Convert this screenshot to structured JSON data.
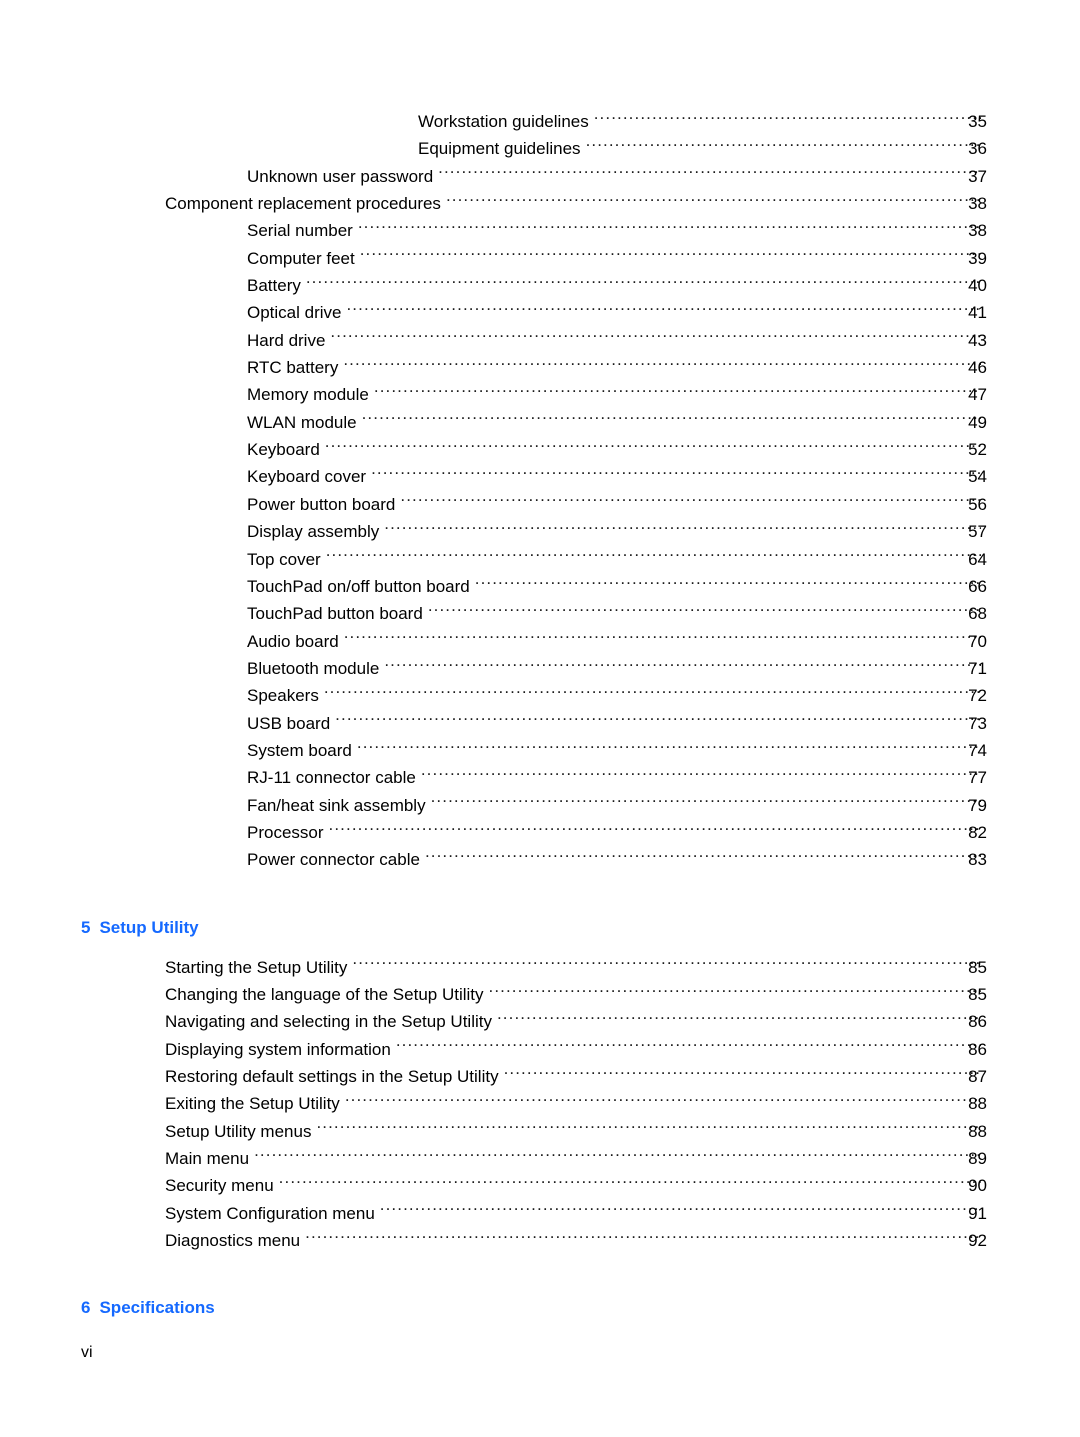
{
  "page": {
    "folio": "vi",
    "heading_color": "#1569ff",
    "text_color": "#000000",
    "background": "#ffffff"
  },
  "toc": {
    "blocks": [
      {
        "type": "entries",
        "entries": [
          {
            "title": "Workstation guidelines",
            "page": "35",
            "level": 3
          },
          {
            "title": "Equipment guidelines",
            "page": "36",
            "level": 3
          },
          {
            "title": "Unknown user password",
            "page": "37",
            "level": 2
          },
          {
            "title": "Component replacement procedures",
            "page": "38",
            "level": 1
          },
          {
            "title": "Serial number",
            "page": "38",
            "level": 2
          },
          {
            "title": "Computer feet",
            "page": "39",
            "level": 2
          },
          {
            "title": "Battery",
            "page": "40",
            "level": 2
          },
          {
            "title": "Optical drive",
            "page": "41",
            "level": 2
          },
          {
            "title": "Hard drive",
            "page": "43",
            "level": 2
          },
          {
            "title": "RTC battery",
            "page": "46",
            "level": 2
          },
          {
            "title": "Memory module",
            "page": "47",
            "level": 2
          },
          {
            "title": "WLAN module",
            "page": "49",
            "level": 2
          },
          {
            "title": "Keyboard",
            "page": "52",
            "level": 2
          },
          {
            "title": "Keyboard cover",
            "page": "54",
            "level": 2
          },
          {
            "title": "Power button board",
            "page": "56",
            "level": 2
          },
          {
            "title": "Display assembly",
            "page": "57",
            "level": 2
          },
          {
            "title": "Top cover",
            "page": "64",
            "level": 2
          },
          {
            "title": "TouchPad on/off button board",
            "page": "66",
            "level": 2
          },
          {
            "title": "TouchPad button board",
            "page": "68",
            "level": 2
          },
          {
            "title": "Audio board",
            "page": "70",
            "level": 2
          },
          {
            "title": "Bluetooth module",
            "page": "71",
            "level": 2
          },
          {
            "title": "Speakers",
            "page": "72",
            "level": 2
          },
          {
            "title": "USB board",
            "page": "73",
            "level": 2
          },
          {
            "title": "System board",
            "page": "74",
            "level": 2
          },
          {
            "title": "RJ-11 connector cable",
            "page": "77",
            "level": 2
          },
          {
            "title": "Fan/heat sink assembly",
            "page": "79",
            "level": 2
          },
          {
            "title": "Processor",
            "page": "82",
            "level": 2
          },
          {
            "title": "Power connector cable",
            "page": "83",
            "level": 2
          }
        ]
      },
      {
        "type": "chapter",
        "number": "5",
        "title": "Setup Utility"
      },
      {
        "type": "entries",
        "entries": [
          {
            "title": "Starting the Setup Utility",
            "page": "85",
            "level": 1
          },
          {
            "title": "Changing the language of the Setup Utility",
            "page": "85",
            "level": 1
          },
          {
            "title": "Navigating and selecting in the Setup Utility",
            "page": "86",
            "level": 1
          },
          {
            "title": "Displaying system information",
            "page": "86",
            "level": 1
          },
          {
            "title": "Restoring default settings in the Setup Utility",
            "page": "87",
            "level": 1
          },
          {
            "title": "Exiting the Setup Utility",
            "page": "88",
            "level": 1
          },
          {
            "title": "Setup Utility menus",
            "page": "88",
            "level": 1
          },
          {
            "title": "Main menu",
            "page": "89",
            "level": 1
          },
          {
            "title": "Security menu",
            "page": "90",
            "level": 1
          },
          {
            "title": "System Configuration menu",
            "page": "91",
            "level": 1
          },
          {
            "title": "Diagnostics menu",
            "page": "92",
            "level": 1
          }
        ]
      },
      {
        "type": "chapter",
        "number": "6",
        "title": "Specifications"
      }
    ]
  }
}
